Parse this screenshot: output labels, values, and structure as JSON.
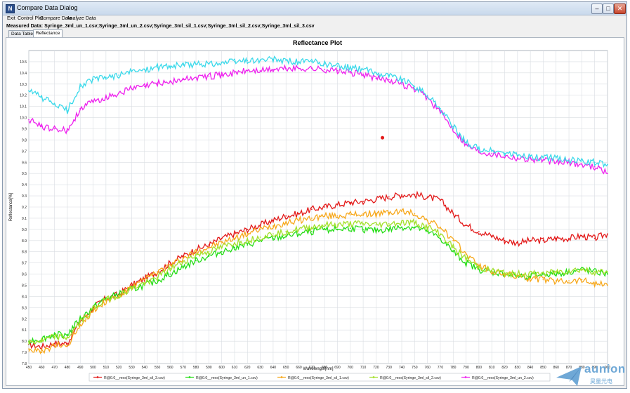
{
  "window": {
    "title": "Compare Data Dialog",
    "icon_name": "app-icon"
  },
  "menu": [
    {
      "label": "Exit"
    },
    {
      "label": "Control Plot"
    },
    {
      "label": "Compare Data"
    },
    {
      "label": "Analyze Data"
    }
  ],
  "measured_data": "Measured Data: Syringe_3ml_un_1.csv;Syringe_3ml_un_2.csv;Syringe_3ml_sil_1.csv;Syringe_3ml_sil_2.csv;Syringe_3ml_sil_3.csv",
  "tabs": [
    {
      "label": "Data Table",
      "active": false
    },
    {
      "label": "Reflectance",
      "active": true
    }
  ],
  "colors": {
    "red": "#e31a1a",
    "green": "#23dd14",
    "orange": "#f7a81b",
    "lime": "#a3e02a",
    "magenta": "#ee22ee",
    "cyan": "#3cd9ea"
  },
  "chart_data": {
    "type": "line",
    "title": "Reflectance Plot",
    "xlabel": "Wavelength[nm]",
    "ylabel": "Reflectance[%]",
    "xlim": [
      450,
      900
    ],
    "ylim": [
      7.8,
      10.6
    ],
    "grid": true,
    "legend_position": "bottom",
    "x_ticks": [
      450,
      460,
      470,
      480,
      490,
      500,
      510,
      520,
      530,
      540,
      550,
      560,
      570,
      580,
      590,
      600,
      610,
      620,
      630,
      640,
      650,
      660,
      670,
      680,
      690,
      700,
      710,
      720,
      730,
      740,
      750,
      760,
      770,
      780,
      790,
      800,
      810,
      820,
      830,
      840,
      850,
      860,
      870,
      880,
      890,
      900
    ],
    "y_ticks": [
      "7.8",
      "7.9",
      "8.0",
      "8.1",
      "8.2",
      "8.3",
      "8.4",
      "8.5",
      "8.6",
      "8.7",
      "8.8",
      "8.9",
      "9.0",
      "9.1",
      "9.2",
      "9.3",
      "9.4",
      "9.5",
      "9.6",
      "9.7",
      "9.8",
      "9.9",
      "10.0",
      "10.1",
      "10.2",
      "10.3",
      "10.4",
      "10.5"
    ],
    "x": [
      450,
      460,
      470,
      480,
      490,
      500,
      510,
      520,
      530,
      540,
      550,
      560,
      570,
      580,
      590,
      600,
      610,
      620,
      630,
      640,
      650,
      660,
      670,
      680,
      690,
      700,
      710,
      720,
      730,
      740,
      750,
      760,
      770,
      780,
      790,
      800,
      810,
      820,
      830,
      840,
      850,
      860,
      870,
      880,
      890,
      900
    ],
    "series": [
      {
        "name": "R@0.0__mes(Syringe_3ml_sil_3.csv)",
        "color": "#e31a1a",
        "values": [
          7.97,
          7.95,
          7.98,
          7.98,
          8.18,
          8.3,
          8.38,
          8.42,
          8.5,
          8.56,
          8.62,
          8.7,
          8.76,
          8.82,
          8.86,
          8.92,
          8.96,
          9.0,
          9.04,
          9.08,
          9.12,
          9.14,
          9.18,
          9.2,
          9.22,
          9.24,
          9.25,
          9.27,
          9.29,
          9.31,
          9.31,
          9.29,
          9.26,
          9.14,
          9.04,
          8.98,
          8.94,
          8.9,
          8.88,
          8.9,
          8.9,
          8.92,
          8.92,
          8.94,
          8.92,
          8.96
        ]
      },
      {
        "name": "R@0.0__mes(Syringe_3ml_un_1.csv)",
        "color": "#23dd14",
        "values": [
          8.0,
          8.02,
          8.06,
          8.06,
          8.2,
          8.3,
          8.38,
          8.42,
          8.46,
          8.5,
          8.54,
          8.6,
          8.66,
          8.72,
          8.76,
          8.8,
          8.84,
          8.86,
          8.9,
          8.92,
          8.94,
          8.96,
          8.98,
          9.0,
          9.0,
          9.01,
          9.0,
          8.99,
          9.0,
          9.02,
          9.02,
          8.98,
          8.92,
          8.8,
          8.7,
          8.64,
          8.62,
          8.6,
          8.58,
          8.58,
          8.6,
          8.6,
          8.62,
          8.64,
          8.62,
          8.6
        ]
      },
      {
        "name": "R@0.0__mes(Syringe_3ml_sil_1.csv)",
        "color": "#f7a81b",
        "values": [
          7.93,
          7.9,
          7.96,
          7.96,
          8.15,
          8.27,
          8.36,
          8.4,
          8.48,
          8.55,
          8.62,
          8.68,
          8.74,
          8.8,
          8.84,
          8.88,
          8.92,
          8.96,
          9.0,
          9.03,
          9.06,
          9.08,
          9.1,
          9.12,
          9.12,
          9.13,
          9.14,
          9.14,
          9.15,
          9.16,
          9.14,
          9.08,
          9.02,
          8.9,
          8.78,
          8.68,
          8.62,
          8.6,
          8.58,
          8.56,
          8.55,
          8.54,
          8.54,
          8.55,
          8.52,
          8.5
        ]
      },
      {
        "name": "R@0.0__mes(Syringe_3ml_sil_2.csv)",
        "color": "#a3e02a",
        "values": [
          7.99,
          8.0,
          8.04,
          8.03,
          8.17,
          8.29,
          8.37,
          8.41,
          8.47,
          8.52,
          8.57,
          8.65,
          8.71,
          8.77,
          8.8,
          8.84,
          8.88,
          8.9,
          8.93,
          8.96,
          8.98,
          9.0,
          9.02,
          9.04,
          9.04,
          9.05,
          9.05,
          9.04,
          9.05,
          9.06,
          9.06,
          9.02,
          8.96,
          8.84,
          8.74,
          8.66,
          8.63,
          8.61,
          8.6,
          8.6,
          8.61,
          8.62,
          8.63,
          8.64,
          8.62,
          8.62
        ]
      },
      {
        "name": "R@0.0__mes(Syringe_3ml_un_2.csv)",
        "color": "#ee22ee",
        "values": [
          9.98,
          9.92,
          9.9,
          9.88,
          10.08,
          10.14,
          10.18,
          10.22,
          10.26,
          10.28,
          10.31,
          10.32,
          10.34,
          10.36,
          10.37,
          10.38,
          10.4,
          10.42,
          10.42,
          10.43,
          10.44,
          10.44,
          10.44,
          10.43,
          10.42,
          10.4,
          10.39,
          10.35,
          10.34,
          10.3,
          10.25,
          10.18,
          10.05,
          9.9,
          9.76,
          9.7,
          9.68,
          9.66,
          9.64,
          9.63,
          9.62,
          9.6,
          9.6,
          9.58,
          9.56,
          9.5
        ]
      },
      {
        "name": "",
        "color": "#3cd9ea",
        "values": [
          10.24,
          10.18,
          10.12,
          10.06,
          10.28,
          10.34,
          10.36,
          10.38,
          10.41,
          10.43,
          10.45,
          10.46,
          10.47,
          10.48,
          10.48,
          10.49,
          10.5,
          10.51,
          10.51,
          10.52,
          10.51,
          10.5,
          10.5,
          10.48,
          10.46,
          10.45,
          10.43,
          10.4,
          10.38,
          10.34,
          10.28,
          10.2,
          10.08,
          9.92,
          9.78,
          9.72,
          9.7,
          9.68,
          9.66,
          9.65,
          9.64,
          9.64,
          9.62,
          9.61,
          9.6,
          9.58
        ]
      }
    ],
    "annotation_point": {
      "x": 725,
      "y": 9.82,
      "color": "#e31a1a"
    }
  },
  "watermark": {
    "brand": "aunion",
    "sub": "昊量光电"
  }
}
